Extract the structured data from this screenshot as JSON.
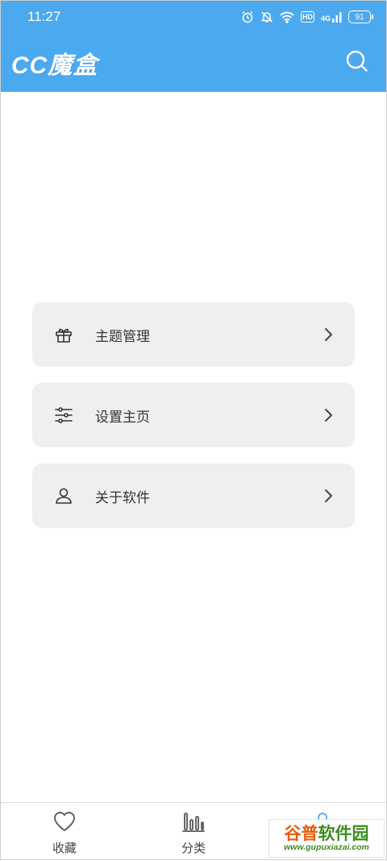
{
  "status_bar": {
    "time": "11:27",
    "network": "4G",
    "hd": "HD",
    "battery": "91"
  },
  "app_bar": {
    "title": "CC魔盒"
  },
  "menu": {
    "items": [
      {
        "label": "主题管理",
        "icon": "gift-icon"
      },
      {
        "label": "设置主页",
        "icon": "sliders-icon"
      },
      {
        "label": "关于软件",
        "icon": "user-icon"
      }
    ]
  },
  "bottom_nav": {
    "items": [
      {
        "label": "收藏",
        "icon": "heart-icon"
      },
      {
        "label": "分类",
        "icon": "bar-chart-icon"
      },
      {
        "label": "",
        "icon": "user-icon",
        "active": true
      }
    ]
  },
  "watermark": {
    "brand_part1": "谷普",
    "brand_part2": "软件园",
    "url": "www.gupuxiazai.com"
  },
  "colors": {
    "primary": "#4BA9F0",
    "card_bg": "#EFEFEF",
    "text": "#333333"
  }
}
